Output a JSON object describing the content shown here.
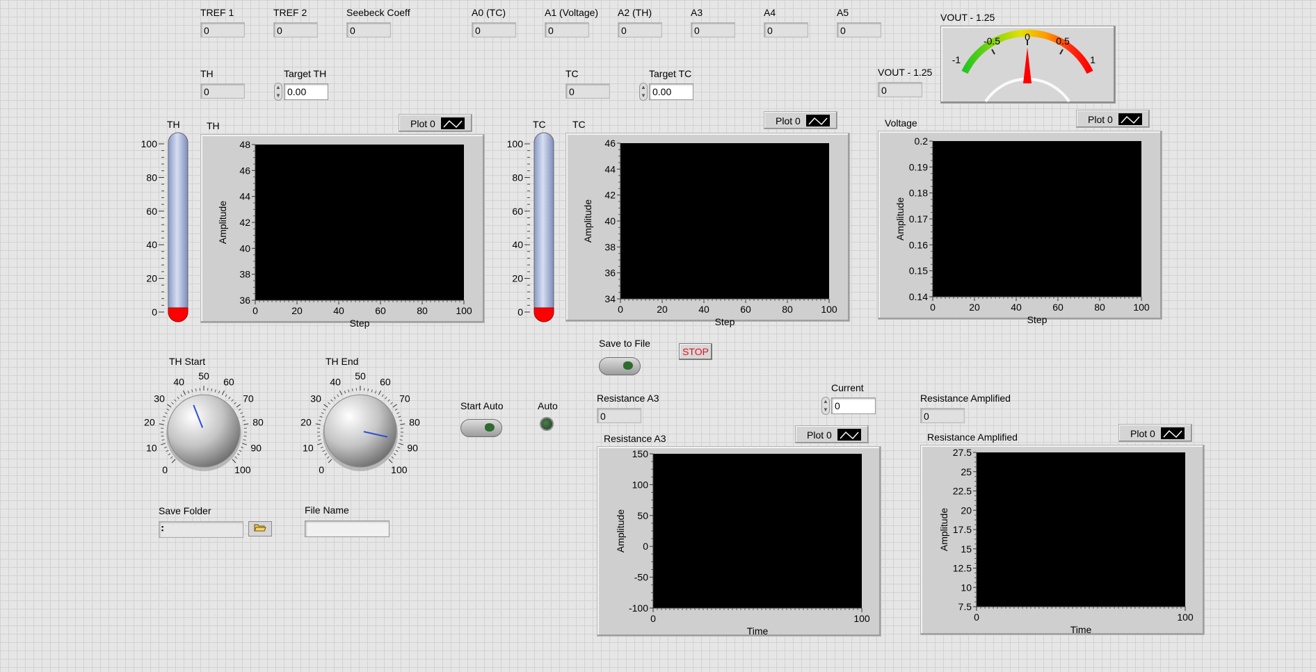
{
  "colors": {
    "panel_bg": "#e6e6e6",
    "grid_line": "#d2d2d2",
    "plot_bg": "#000000",
    "stop_text": "#e0101f",
    "needle": "#ff0000"
  },
  "top_indicators": [
    {
      "label": "TREF 1",
      "value": "0"
    },
    {
      "label": "TREF 2",
      "value": "0"
    },
    {
      "label": "Seebeck Coeff",
      "value": "0"
    },
    {
      "label": "A0 (TC)",
      "value": "0"
    },
    {
      "label": "A1 (Voltage)",
      "value": "0"
    },
    {
      "label": "A2 (TH)",
      "value": "0"
    },
    {
      "label": "A3",
      "value": "0"
    },
    {
      "label": "A4",
      "value": "0"
    },
    {
      "label": "A5",
      "value": "0"
    }
  ],
  "th": {
    "label": "TH",
    "value": "0",
    "target_label": "Target TH",
    "target_value": "0.00"
  },
  "tc": {
    "label": "TC",
    "value": "0",
    "target_label": "Target TC",
    "target_value": "0.00"
  },
  "vout": {
    "label": "VOUT - 1.25",
    "value": "0"
  },
  "meter": {
    "label": "VOUT - 1.25",
    "ticks": [
      "-1",
      "-0.5",
      "0",
      "0.5",
      "1"
    ],
    "value": 0
  },
  "thermo_th": {
    "label": "TH",
    "ticks": [
      "100",
      "80",
      "60",
      "40",
      "20",
      "0"
    ],
    "value": 0
  },
  "thermo_tc": {
    "label": "TC",
    "ticks": [
      "100",
      "80",
      "60",
      "40",
      "20",
      "0"
    ],
    "value": 0
  },
  "chart_data": [
    {
      "type": "line",
      "title": "TH",
      "legend": "Plot 0",
      "xlabel": "Step",
      "ylabel": "Amplitude",
      "xlim": [
        0,
        100
      ],
      "ylim": [
        36,
        48
      ],
      "xticks": [
        "0",
        "20",
        "40",
        "60",
        "80",
        "100"
      ],
      "yticks": [
        "48",
        "46",
        "44",
        "42",
        "40",
        "38",
        "36"
      ],
      "series": [
        {
          "name": "Plot 0",
          "x": [],
          "y": []
        }
      ]
    },
    {
      "type": "line",
      "title": "TC",
      "legend": "Plot 0",
      "xlabel": "Step",
      "ylabel": "Amplitude",
      "xlim": [
        0,
        100
      ],
      "ylim": [
        34,
        46
      ],
      "xticks": [
        "0",
        "20",
        "40",
        "60",
        "80",
        "100"
      ],
      "yticks": [
        "46",
        "44",
        "42",
        "40",
        "38",
        "36",
        "34"
      ],
      "series": [
        {
          "name": "Plot 0",
          "x": [],
          "y": []
        }
      ]
    },
    {
      "type": "line",
      "title": "Voltage",
      "legend": "Plot 0",
      "xlabel": "Step",
      "ylabel": "Amplitude",
      "xlim": [
        0,
        100
      ],
      "ylim": [
        0.14,
        0.2
      ],
      "xticks": [
        "0",
        "20",
        "40",
        "60",
        "80",
        "100"
      ],
      "yticks": [
        "0.2",
        "0.19",
        "0.18",
        "0.17",
        "0.16",
        "0.15",
        "0.14"
      ],
      "series": [
        {
          "name": "Plot 0",
          "x": [],
          "y": []
        }
      ]
    },
    {
      "type": "line",
      "title": "Resistance A3",
      "legend": "Plot 0",
      "xlabel": "Time",
      "ylabel": "Amplitude",
      "xlim": [
        0,
        100
      ],
      "ylim": [
        -100,
        150
      ],
      "xticks": [
        "0",
        "100"
      ],
      "yticks": [
        "150",
        "100",
        "50",
        "0",
        "-50",
        "-100"
      ],
      "series": [
        {
          "name": "Plot 0",
          "x": [],
          "y": []
        }
      ]
    },
    {
      "type": "line",
      "title": "Resistance Amplified",
      "legend": "Plot 0",
      "xlabel": "Time",
      "ylabel": "Amplitude",
      "xlim": [
        0,
        100
      ],
      "ylim": [
        7.5,
        27.5
      ],
      "xticks": [
        "0",
        "100"
      ],
      "yticks": [
        "27.5",
        "25",
        "22.5",
        "20",
        "17.5",
        "15",
        "12.5",
        "10",
        "7.5"
      ],
      "series": [
        {
          "name": "Plot 0",
          "x": [],
          "y": []
        }
      ]
    }
  ],
  "knobs": [
    {
      "label": "TH Start",
      "ticks": [
        "0",
        "10",
        "20",
        "30",
        "40",
        "50",
        "60",
        "70",
        "80",
        "90",
        "100"
      ],
      "value": 42
    },
    {
      "label": "TH End",
      "ticks": [
        "0",
        "10",
        "20",
        "30",
        "40",
        "50",
        "60",
        "70",
        "80",
        "90",
        "100"
      ],
      "value": 88
    }
  ],
  "save_folder": {
    "label": "Save Folder",
    "value": "",
    "browse_icon": "folder-open-icon"
  },
  "file_name": {
    "label": "File Name",
    "value": ""
  },
  "start_auto": {
    "label": "Start Auto"
  },
  "auto": {
    "label": "Auto"
  },
  "save_to_file": {
    "label": "Save to File"
  },
  "stop": {
    "label": "STOP"
  },
  "resistance_a3": {
    "label": "Resistance A3",
    "value": "0"
  },
  "current": {
    "label": "Current",
    "value": "0"
  },
  "resistance_amplified": {
    "label": "Resistance Amplified",
    "value": "0"
  }
}
